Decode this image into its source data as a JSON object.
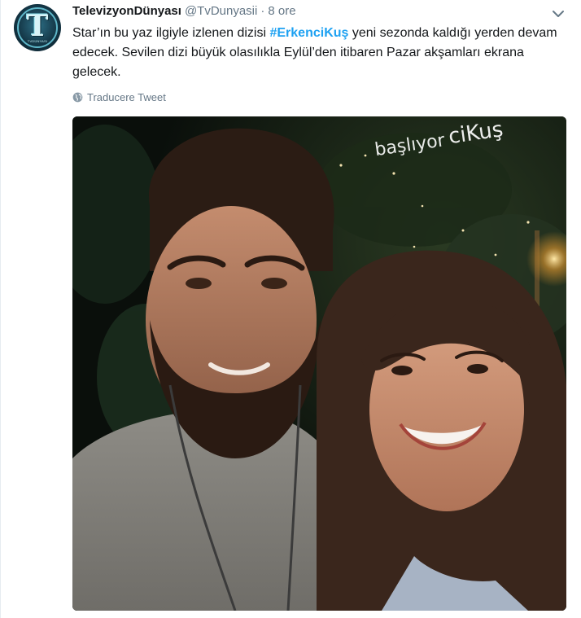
{
  "tweet": {
    "author": {
      "full_name": "TelevizyonDünyası",
      "handle": "@TvDunyasii",
      "avatar_letter": "T",
      "avatar_caption": "TVDÜNYASI"
    },
    "separator": "·",
    "time": "8 ore",
    "text": {
      "before": "Star’ın bu yaz ilgiyle izlenen dizisi ",
      "hashtag": "#ErkenciKuş",
      "after": " yeni sezonda kaldığı yerden devam edecek. Sevilen dizi büyük olasılıkla Eylül’den itibaren Pazar akşamları ekrana gelecek."
    },
    "translate_label": "Traducere Tweet",
    "media": {
      "overlay_text_1": "ciKuş",
      "overlay_text_2": "başlıyor"
    },
    "icons": {
      "menu": "chevron-down-icon",
      "translate": "globe-icon"
    },
    "colors": {
      "link": "#1da1f2",
      "secondary": "#657786",
      "primary": "#14171a"
    }
  }
}
